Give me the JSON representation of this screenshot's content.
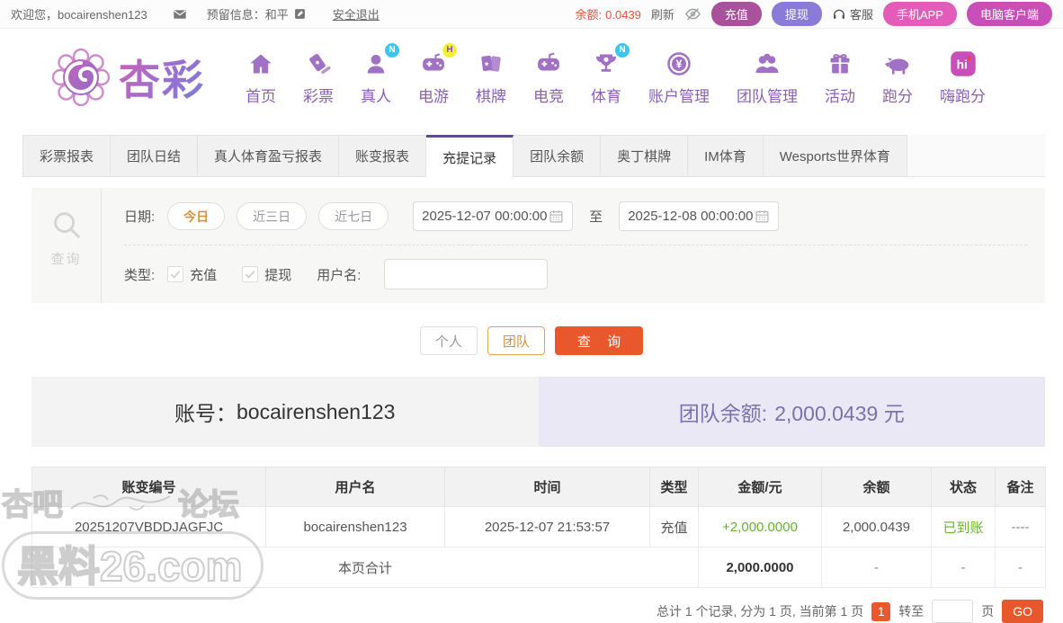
{
  "topbar": {
    "welcome": "欢迎您，bocairenshen123",
    "reserved_info": "预留信息：和平",
    "logout": "安全退出",
    "balance_label": "余额:",
    "balance_value": "0.0439",
    "refresh": "刷新",
    "deposit": "充值",
    "withdraw": "提现",
    "service": "客服",
    "mobile_app": "手机APP",
    "pc_client": "电脑客户端"
  },
  "brand": {
    "name": "杏彩"
  },
  "nav": {
    "items": [
      {
        "label": "首页",
        "icon": "home-icon",
        "badge": ""
      },
      {
        "label": "彩票",
        "icon": "lottery-ticket-icon",
        "badge": ""
      },
      {
        "label": "真人",
        "icon": "live-person-icon",
        "badge": "N"
      },
      {
        "label": "电游",
        "icon": "slot-games-icon",
        "badge": "H"
      },
      {
        "label": "棋牌",
        "icon": "cards-icon",
        "badge": ""
      },
      {
        "label": "电竞",
        "icon": "esports-gamepad-icon",
        "badge": ""
      },
      {
        "label": "体育",
        "icon": "sports-trophy-icon",
        "badge": "N"
      },
      {
        "label": "账户管理",
        "icon": "account-coin-icon",
        "badge": ""
      },
      {
        "label": "团队管理",
        "icon": "team-people-icon",
        "badge": ""
      },
      {
        "label": "活动",
        "icon": "gift-icon",
        "badge": ""
      },
      {
        "label": "跑分",
        "icon": "rhino-icon",
        "badge": ""
      },
      {
        "label": "嗨跑分",
        "icon": "hi-app-icon",
        "badge": ""
      }
    ]
  },
  "tabs": {
    "active_index": 4,
    "items": [
      {
        "label": "彩票报表"
      },
      {
        "label": "团队日结"
      },
      {
        "label": "真人体育盈亏报表"
      },
      {
        "label": "账变报表"
      },
      {
        "label": "充提记录"
      },
      {
        "label": "团队余额"
      },
      {
        "label": "奥丁棋牌"
      },
      {
        "label": "IM体育"
      },
      {
        "label": "Wesports世界体育"
      }
    ]
  },
  "filter": {
    "panel_label": "查询",
    "date_label": "日期:",
    "presets": [
      {
        "label": "今日",
        "active": true
      },
      {
        "label": "近三日",
        "active": false
      },
      {
        "label": "近七日",
        "active": false
      }
    ],
    "date_from": "2025-12-07 00:00:00",
    "to_label": "至",
    "date_to": "2025-12-08 00:00:00",
    "type_label": "类型:",
    "type_options": [
      {
        "label": "充值",
        "checked": true
      },
      {
        "label": "提现",
        "checked": true
      }
    ],
    "username_label": "用户名:",
    "username_value": ""
  },
  "actions": {
    "personal": "个人",
    "team": "团队",
    "query": "查 询"
  },
  "account": {
    "label": "账号：",
    "value": "bocairenshen123",
    "team_balance_label": "团队余额:",
    "team_balance_value": "2,000.0439 元"
  },
  "table": {
    "headers": [
      "账变编号",
      "用户名",
      "时间",
      "类型",
      "金额/元",
      "余额",
      "状态",
      "备注"
    ],
    "rows": [
      [
        "20251207VBDDJAGFJC",
        "bocairenshen123",
        "2025-12-07 21:53:57",
        "充值",
        "+2,000.0000",
        "2,000.0439",
        "已到账",
        "----"
      ]
    ],
    "summary": {
      "label": "本页合计",
      "amount": "2,000.0000",
      "dash": "-"
    }
  },
  "pagination": {
    "summary": "总计 1 个记录, 分为 1 页, 当前第 1 页",
    "current_page": "1",
    "goto_label": "转至",
    "page_label": "页",
    "go_label": "GO"
  },
  "watermark": {
    "word1": "杏吧",
    "word2": "论坛",
    "site": "黑料26.com"
  },
  "colors": {
    "accent_orange": "#e8582c",
    "preset_orange": "#dd8f33",
    "green": "#64b32d",
    "tab_purple": "#5e4b8b",
    "nav_purple": "#8a5fb5",
    "lavender_bg": "#eae8f5",
    "deposit_magenta": "#a8529c",
    "withdraw_purple": "#8a7bd8",
    "mobile_pink": "#e45cba",
    "pc_magenta": "#c94fb8",
    "balance_red": "#e0543a"
  }
}
